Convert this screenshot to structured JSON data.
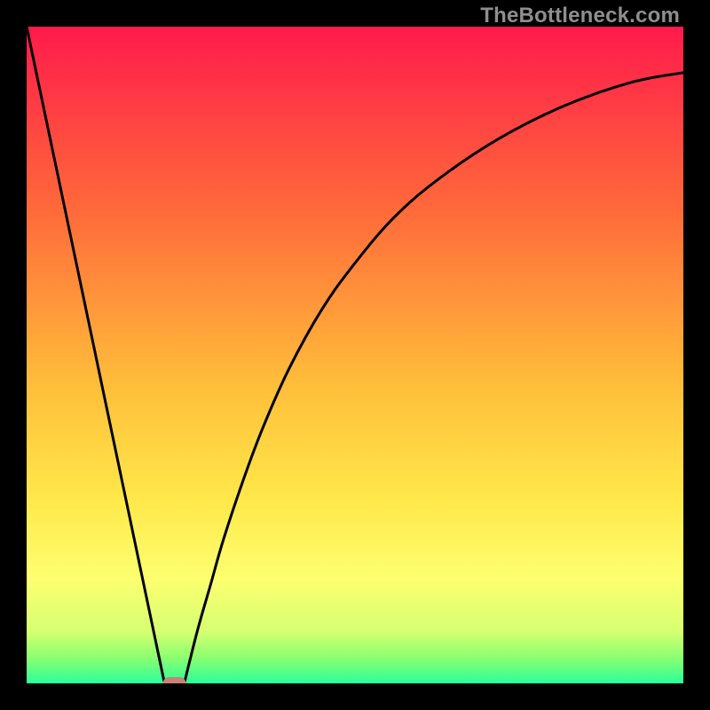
{
  "watermark": "TheBottleneck.com",
  "chart_data": {
    "type": "line",
    "title": "",
    "xlabel": "",
    "ylabel": "",
    "xlim": [
      0,
      100
    ],
    "ylim": [
      0,
      100
    ],
    "gradient_stops": [
      {
        "offset": 0,
        "color": "#ff1a4b"
      },
      {
        "offset": 28,
        "color": "#ff6a3a"
      },
      {
        "offset": 55,
        "color": "#ffbf3a"
      },
      {
        "offset": 72,
        "color": "#ffe84a"
      },
      {
        "offset": 84,
        "color": "#fdff70"
      },
      {
        "offset": 92,
        "color": "#d7ff70"
      },
      {
        "offset": 96,
        "color": "#8dff70"
      },
      {
        "offset": 100,
        "color": "#2bff9a"
      }
    ],
    "series": [
      {
        "name": "left-leg",
        "type": "line",
        "x": [
          0,
          21
        ],
        "values": [
          100,
          0
        ]
      },
      {
        "name": "right-curve",
        "type": "line",
        "x": [
          24,
          26,
          28,
          30,
          33,
          36,
          40,
          45,
          50,
          56,
          63,
          72,
          82,
          92,
          100
        ],
        "values": [
          0,
          8,
          15,
          22,
          31,
          39,
          48,
          57,
          64,
          71,
          77,
          83,
          88,
          91.5,
          93
        ]
      }
    ],
    "marker": {
      "name": "optimal-marker",
      "x": 22.5,
      "y": 0,
      "width": 3.5,
      "color": "#cb8177"
    }
  }
}
